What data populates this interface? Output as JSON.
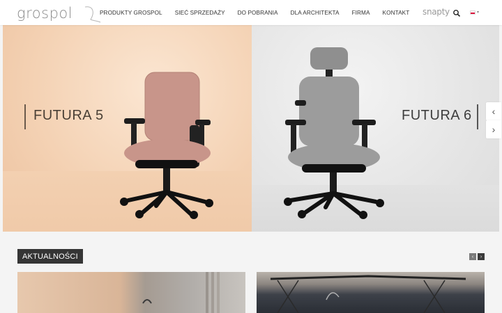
{
  "brand": {
    "logo_text": "grospol"
  },
  "nav": {
    "items": [
      {
        "label": "PRODUKTY GROSPOL"
      },
      {
        "label": "SIEĆ SPRZEDAŻY"
      },
      {
        "label": "DO POBRANIA"
      },
      {
        "label": "DLA ARCHITEKTA"
      },
      {
        "label": "FIRMA"
      },
      {
        "label": "KONTAKT"
      }
    ],
    "snapty_label": "snapty",
    "search_icon": "search-icon",
    "language": "PL"
  },
  "hero": {
    "slides": [
      {
        "label": "FUTURA 5",
        "chair_color": "#c9968a"
      },
      {
        "label": "FUTURA 6",
        "chair_color": "#9c9c9c"
      }
    ],
    "prev_icon": "chevron-left-icon",
    "next_icon": "chevron-right-icon"
  },
  "news": {
    "title": "AKTUALNOŚCI",
    "prev_icon": "chevron-left-icon",
    "next_icon": "chevron-right-icon"
  },
  "colors": {
    "header_bg": "#ffffff",
    "news_badge_bg": "#353535",
    "page_bg": "#f4f4f4"
  }
}
